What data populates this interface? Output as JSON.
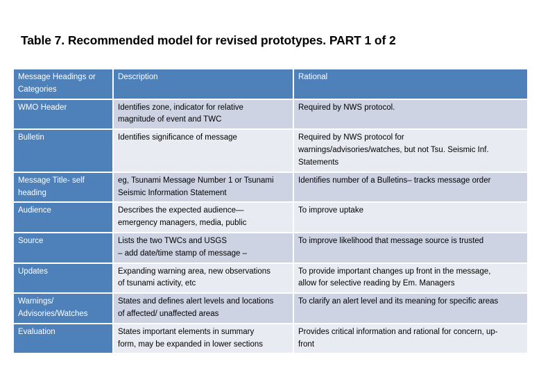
{
  "slide": {
    "title": "Table 7. Recommended model for revised prototypes. PART 1 of 2"
  },
  "colors": {
    "header_blue": "#4E80BA",
    "band_a": "#CDD3E3",
    "band_b": "#E9EBF2",
    "text_dark": "#000000",
    "text_light": "#FFFFFF",
    "background": "#FFFFFF"
  },
  "table": {
    "columns": [
      {
        "key": "category",
        "label_line1": "Message Headings or",
        "label_line2": "Categories"
      },
      {
        "key": "description",
        "label_line1": "Description",
        "label_line2": ""
      },
      {
        "key": "rational",
        "label_line1": "Rational",
        "label_line2": ""
      }
    ],
    "rows": [
      {
        "category": [
          "WMO Header"
        ],
        "description": [
          "Identifies zone, indicator for relative",
          "magnitude of event and TWC"
        ],
        "rational": [
          "Required by NWS protocol."
        ]
      },
      {
        "category": [
          "Bulletin"
        ],
        "description": [
          "Identifies significance of message"
        ],
        "rational": [
          "Required by NWS protocol for",
          "warnings/advisories/watches, but not Tsu. Seismic Inf.",
          "Statements"
        ]
      },
      {
        "category": [
          "Message Title- self",
          "heading"
        ],
        "description": [
          "eg, Tsunami Message Number 1 or Tsunami",
          "Seismic Information Statement"
        ],
        "rational": [
          "Identifies number of a Bulletins– tracks message order"
        ]
      },
      {
        "category": [
          "Audience"
        ],
        "description": [
          "Describes the expected audience—",
          "emergency managers, media, public"
        ],
        "rational": [
          "To improve uptake"
        ]
      },
      {
        "category": [
          "Source"
        ],
        "description": [
          "Lists the two TWCs and USGS",
          "– add date/time stamp of message –"
        ],
        "rational": [
          "To improve likelihood that message source is trusted"
        ]
      },
      {
        "category": [
          "Updates"
        ],
        "description": [
          "Expanding warning area, new observations",
          "of tsunami activity, etc"
        ],
        "rational": [
          "To provide important changes up front in the message,",
          "allow for selective reading by Em. Managers"
        ]
      },
      {
        "category": [
          "Warnings/",
          "Advisories/Watches"
        ],
        "description": [
          "States and defines alert levels and locations",
          "of affected/ unaffected areas"
        ],
        "rational": [
          "To clarify an alert level and its meaning for specific areas"
        ]
      },
      {
        "category": [
          "Evaluation"
        ],
        "description": [
          "States important elements in summary",
          "form, may be expanded in lower sections"
        ],
        "rational": [
          "Provides critical information and rational for concern, up-",
          "front"
        ]
      }
    ]
  }
}
